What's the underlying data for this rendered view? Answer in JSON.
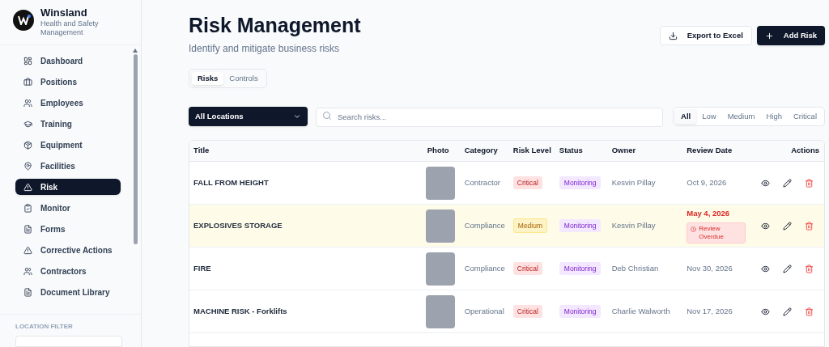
{
  "brand": {
    "name": "Winsland",
    "subtitle": "Health and Safety Management"
  },
  "sidebar": {
    "items": [
      {
        "label": "Dashboard",
        "selected": false
      },
      {
        "label": "Positions",
        "selected": false
      },
      {
        "label": "Employees",
        "selected": false
      },
      {
        "label": "Training",
        "selected": false
      },
      {
        "label": "Equipment",
        "selected": false
      },
      {
        "label": "Facilities",
        "selected": false
      },
      {
        "label": "Risk",
        "selected": true
      },
      {
        "label": "Monitor",
        "selected": false
      },
      {
        "label": "Forms",
        "selected": false
      },
      {
        "label": "Corrective Actions",
        "selected": false
      },
      {
        "label": "Contractors",
        "selected": false
      },
      {
        "label": "Document Library",
        "selected": false
      }
    ],
    "location_filter_label": "LOCATION FILTER"
  },
  "header": {
    "title": "Risk Management",
    "subtitle": "Identify and mitigate business risks",
    "buttons": [
      {
        "label": "Export to Excel",
        "kind": "secondary"
      },
      {
        "label": "Add Risk",
        "kind": "primary"
      }
    ]
  },
  "tabs": [
    {
      "label": "Risks",
      "selected": true
    },
    {
      "label": "Controls",
      "selected": false
    }
  ],
  "location_select": {
    "value": "All Locations"
  },
  "search": {
    "placeholder": "Search risks..."
  },
  "level_filter": [
    {
      "label": "All",
      "selected": true
    },
    {
      "label": "Low",
      "selected": false
    },
    {
      "label": "Medium",
      "selected": false
    },
    {
      "label": "High",
      "selected": false
    },
    {
      "label": "Critical",
      "selected": false
    }
  ],
  "table": {
    "columns": [
      "Title",
      "Photo",
      "Category",
      "Risk Level",
      "Status",
      "Owner",
      "Review Date",
      "Actions"
    ],
    "rows": [
      {
        "title": "FALL FROM HEIGHT",
        "category": "Contractor",
        "risk_level": {
          "label": "Critical",
          "kind": "critical"
        },
        "status": "Monitoring",
        "owner": "Kesvin Pillay",
        "review_date": "Oct 9, 2026",
        "overdue": false
      },
      {
        "title": "EXPLOSIVES STORAGE",
        "category": "Compliance",
        "risk_level": {
          "label": "Medium",
          "kind": "medium"
        },
        "status": "Monitoring",
        "owner": "Kesvin Pillay",
        "review_date": "May 4, 2026",
        "overdue": true,
        "overdue_label": "Review Overdue"
      },
      {
        "title": "FIRE",
        "category": "Compliance",
        "risk_level": {
          "label": "Critical",
          "kind": "critical"
        },
        "status": "Monitoring",
        "owner": "Deb Christian",
        "review_date": "Nov 30, 2026",
        "overdue": false
      },
      {
        "title": "MACHINE RISK - Forklifts",
        "category": "Operational",
        "risk_level": {
          "label": "Critical",
          "kind": "critical"
        },
        "status": "Monitoring",
        "owner": "Charlie Walworth",
        "review_date": "Nov 17, 2026",
        "overdue": false
      }
    ]
  }
}
